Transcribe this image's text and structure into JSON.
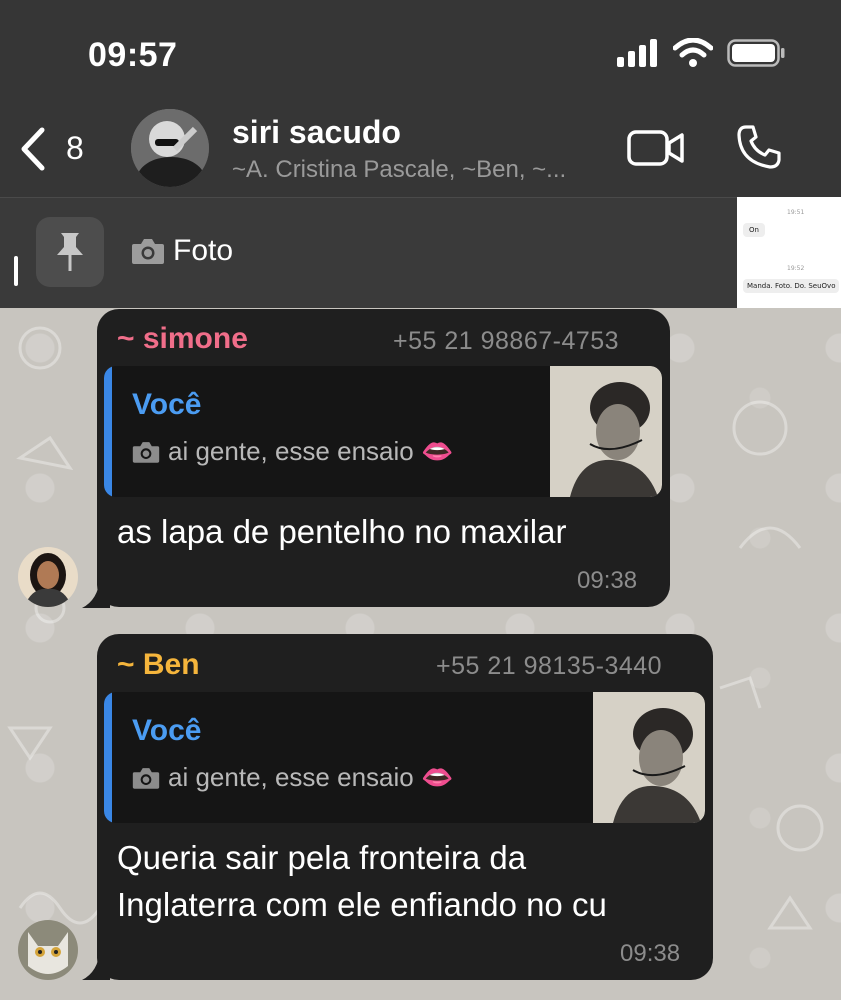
{
  "status_bar": {
    "time": "09:57"
  },
  "header": {
    "back_count": "8",
    "group_name": "siri sacudo",
    "members": "~A. Cristina Pascale, ~Ben, ~..."
  },
  "pinned": {
    "caption": "Foto",
    "thumb_time_1": "19:51",
    "thumb_msg_1": "On",
    "thumb_time_2": "19:52",
    "thumb_msg_2": "Manda. Foto. Do. SeuOvo"
  },
  "messages": [
    {
      "sender": "~ simone",
      "phone": "+55 21 98867-4753",
      "quote_author": "Você",
      "quote_text": "ai gente, esse ensaio 👄",
      "text": "as lapa de pentelho no maxilar",
      "time": "09:38",
      "sender_color": "#f06e8a"
    },
    {
      "sender": "~ Ben",
      "phone": "+55 21 98135-3440",
      "quote_author": "Você",
      "quote_text": "ai gente, esse ensaio 👄",
      "text_line1": "Queria sair pela fronteira da",
      "text_line2": "Inglaterra com ele enfiando no cu",
      "time": "09:38",
      "sender_color": "#f5b53c"
    }
  ],
  "colors": {
    "header_bg": "#363636",
    "bubble_bg": "#1f1f1f",
    "quote_accent": "#3a87e6",
    "wallpaper": "#c8c5bf"
  }
}
